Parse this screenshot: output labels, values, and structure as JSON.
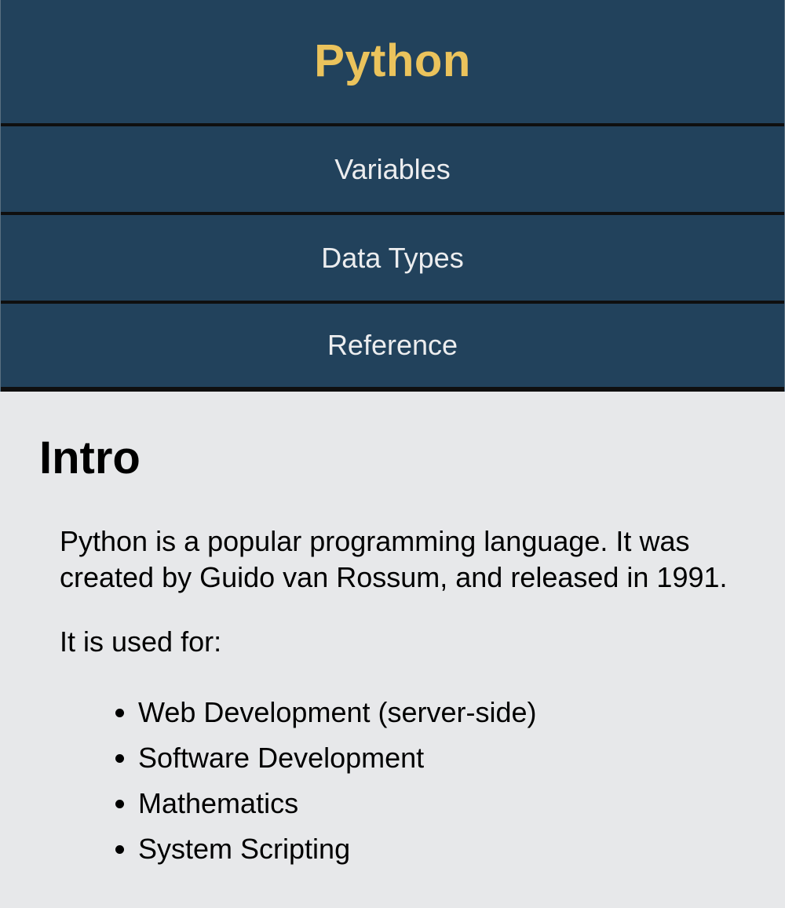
{
  "nav": {
    "title": "Python",
    "items": [
      {
        "label": "Variables"
      },
      {
        "label": "Data Types"
      },
      {
        "label": "Reference"
      }
    ]
  },
  "main": {
    "heading": "Intro",
    "paragraphs": [
      "Python is a popular programming language. It was created by Guido van Rossum, and released in 1991.",
      "It is used for:"
    ],
    "uses": [
      "Web Development (server-side)",
      "Software Development",
      "Mathematics",
      "System Scripting"
    ]
  },
  "colors": {
    "nav_background": "#22425c",
    "title_accent": "#ebc35c",
    "nav_text": "#ecedef",
    "page_background": "#e7e8ea",
    "divider": "#0f0f0f"
  }
}
